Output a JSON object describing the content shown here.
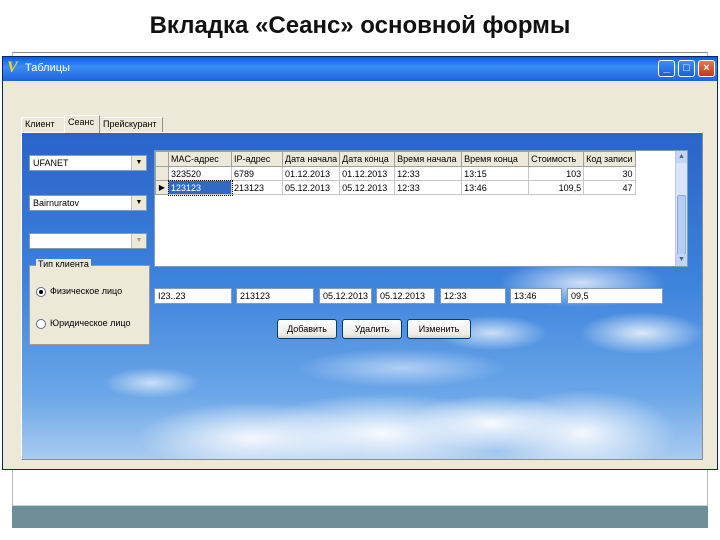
{
  "slide": {
    "title": "Вкладка «Сеанс» основной формы"
  },
  "window": {
    "title": "Таблицы",
    "icon": "delphi-v-icon",
    "controls": {
      "minimize": "_",
      "maximize": "□",
      "close": "×"
    }
  },
  "tabs": [
    {
      "label": "Клиент",
      "active": false
    },
    {
      "label": "Сеанс",
      "active": true
    },
    {
      "label": "Прейскурант",
      "active": false
    }
  ],
  "left_panel": {
    "combo1": "UFANET",
    "combo2": "Bairnuratov",
    "combo3": "",
    "client_type": {
      "legend": "Тип клиента",
      "options": [
        {
          "label": "Физическое лицо",
          "selected": true
        },
        {
          "label": "Юридическое лицо",
          "selected": false
        }
      ]
    }
  },
  "grid": {
    "columns": [
      "MAC-адрес",
      "IP-адрес",
      "Дата начала",
      "Дата конца",
      "Время начала",
      "Время конца",
      "Стоимость",
      "Код записи"
    ],
    "rows": [
      {
        "indicator": "",
        "cells": [
          "323520",
          "6789",
          "01.12.2013",
          "01.12.2013",
          "12:33",
          "13:15",
          "103",
          "30"
        ]
      },
      {
        "indicator": "▶",
        "cells": [
          "123123",
          "213123",
          "05.12.2013",
          "05.12.2013",
          "12:33",
          "13:46",
          "109,5",
          "47"
        ]
      }
    ]
  },
  "edit_fields": [
    "I23..23",
    "213123",
    "05.12.2013",
    "05.12.2013",
    "12:33",
    "13:46",
    "09,5"
  ],
  "buttons": {
    "add": "Добавить",
    "delete": "Удалить",
    "edit": "Изменить"
  },
  "colors": {
    "titlebar": "#0a5ee0",
    "selection": "#316ac5",
    "window_face": "#ece9d8",
    "footer_bar": "#6f8f98"
  }
}
